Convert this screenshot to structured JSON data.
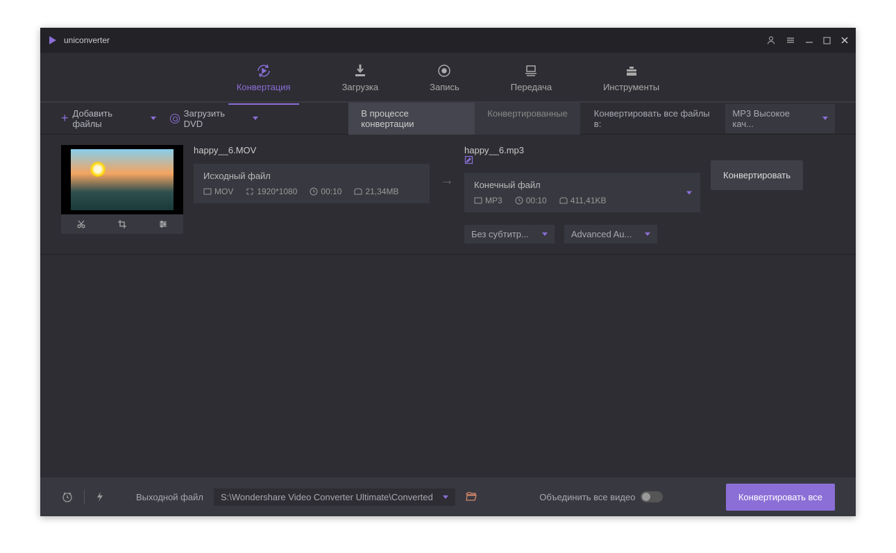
{
  "app": {
    "title": "uniconverter"
  },
  "tabs": {
    "convert": "Конвертация",
    "download": "Загрузка",
    "record": "Запись",
    "transfer": "Передача",
    "tools": "Инструменты"
  },
  "toolbar": {
    "add_files": "Добавить файлы",
    "load_dvd": "Загрузить DVD",
    "sub_in_progress": "В процессе конвертации",
    "sub_converted": "Конвертированные",
    "convert_all_to": "Конвертировать все файлы в:",
    "format_selected": "MP3 Высокое кач..."
  },
  "file": {
    "source_name": "happy__6.MOV",
    "target_name": "happy__6.mp3",
    "source_box_title": "Исходный файл",
    "target_box_title": "Конечный файл",
    "source": {
      "format": "MOV",
      "resolution": "1920*1080",
      "duration": "00:10",
      "size": "21,34MB"
    },
    "target": {
      "format": "MP3",
      "duration": "00:10",
      "size": "411,41KB"
    },
    "subtitle_select": "Без субтитр...",
    "audio_select": "Advanced Au...",
    "convert_btn": "Конвертировать"
  },
  "bottom": {
    "output_label": "Выходной файл",
    "output_path": "S:\\Wondershare Video Converter Ultimate\\Converted",
    "merge_label": "Объединить все видео",
    "convert_all": "Конвертировать все"
  }
}
